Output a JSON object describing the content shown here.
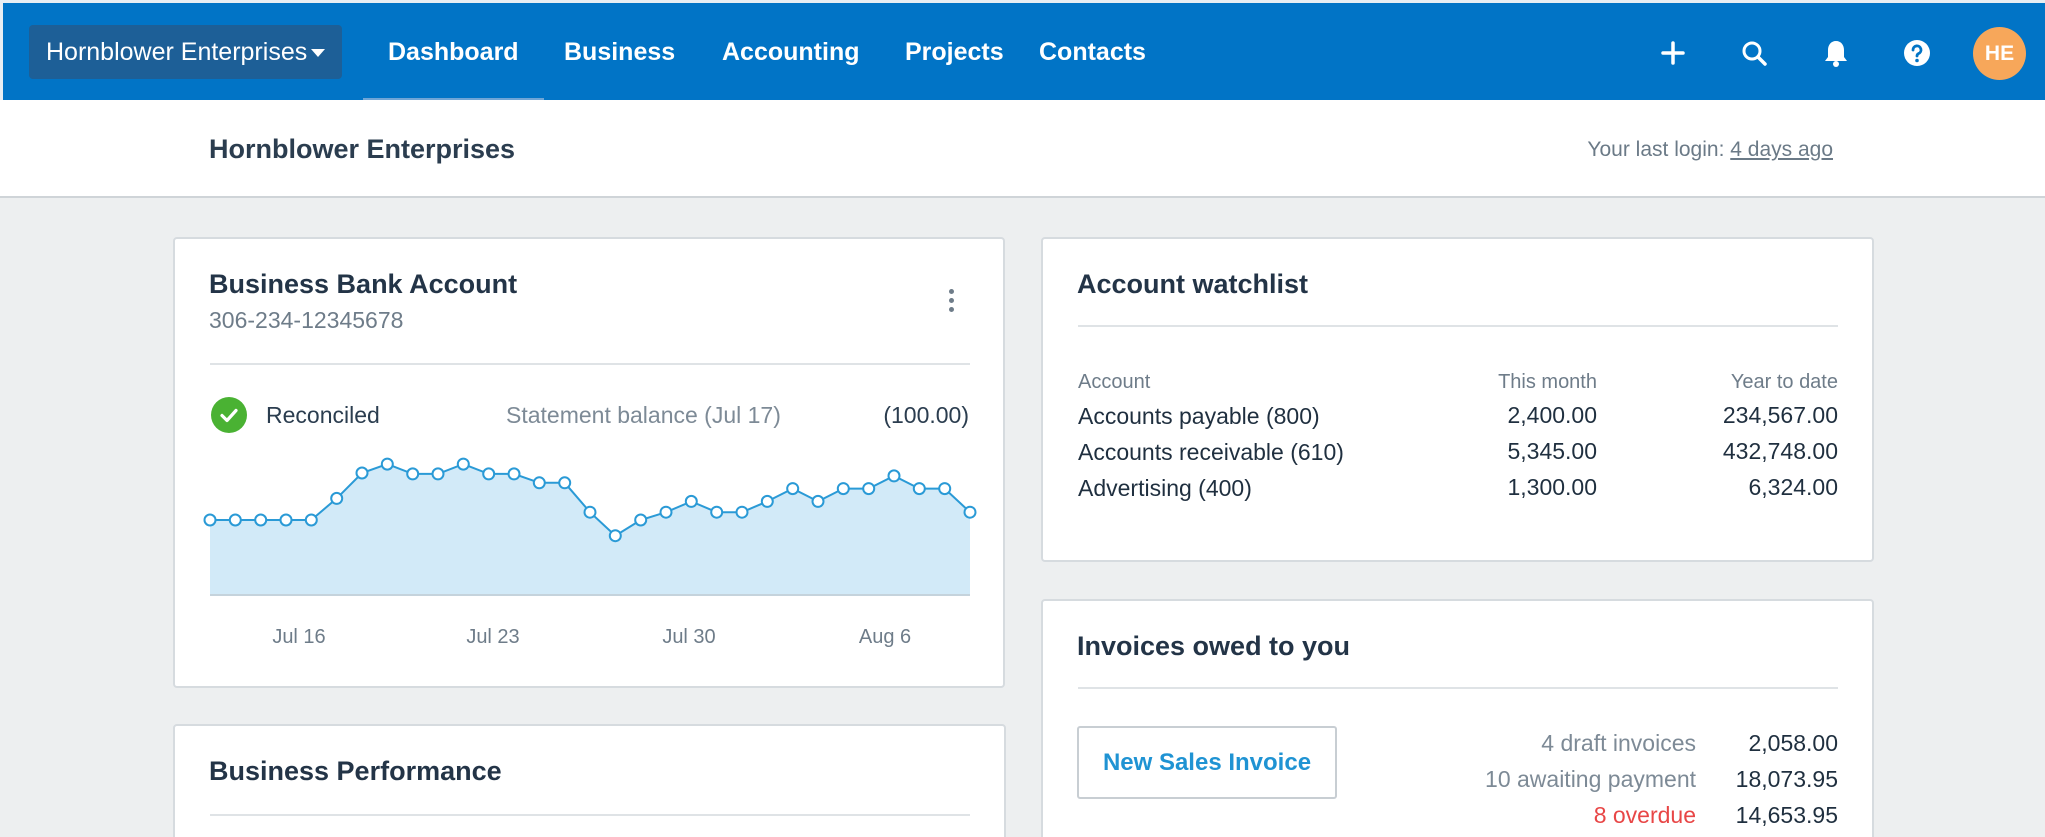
{
  "nav": {
    "org_name": "Hornblower Enterprises",
    "links": [
      "Dashboard",
      "Business",
      "Accounting",
      "Projects",
      "Contacts"
    ],
    "active": "Dashboard",
    "avatar_initials": "HE",
    "icons": [
      "plus-icon",
      "search-icon",
      "bell-icon",
      "help-icon"
    ]
  },
  "header": {
    "title": "Hornblower Enterprises",
    "last_login_prefix": "Your last login:",
    "last_login_link": "4 days ago"
  },
  "bank": {
    "title": "Business Bank Account",
    "account_number": "306-234-12345678",
    "status": "Reconciled",
    "statement_label": "Statement balance (Jul 17)",
    "statement_value": "(100.00)"
  },
  "chart_data": {
    "type": "area",
    "x_ticks": [
      "Jul 16",
      "Jul 23",
      "Jul 30",
      "Aug 6"
    ],
    "values": [
      0,
      0,
      0,
      0,
      0,
      22,
      48,
      57,
      47,
      47,
      57,
      47,
      47,
      38,
      38,
      8,
      -16,
      0,
      8,
      19,
      8,
      8,
      19,
      32,
      19,
      32,
      32,
      45,
      32,
      32,
      8
    ],
    "grid": false,
    "fill_color": "#d2eaf8",
    "line_color": "#2a9ad6"
  },
  "performance": {
    "title": "Business Performance"
  },
  "watchlist": {
    "title": "Account watchlist",
    "columns": [
      "Account",
      "This month",
      "Year to date"
    ],
    "rows": [
      {
        "account": "Accounts payable (800)",
        "month": "2,400.00",
        "ytd": "234,567.00"
      },
      {
        "account": "Accounts receivable (610)",
        "month": "5,345.00",
        "ytd": "432,748.00"
      },
      {
        "account": "Advertising (400)",
        "month": "1,300.00",
        "ytd": "6,324.00"
      }
    ]
  },
  "invoices": {
    "title": "Invoices owed to you",
    "button": "New Sales Invoice",
    "rows": [
      {
        "label": "4 draft invoices",
        "value": "2,058.00",
        "overdue": false
      },
      {
        "label": "10 awaiting payment",
        "value": "18,073.95",
        "overdue": false
      },
      {
        "label": "8 overdue",
        "value": "14,653.95",
        "overdue": true
      }
    ]
  }
}
